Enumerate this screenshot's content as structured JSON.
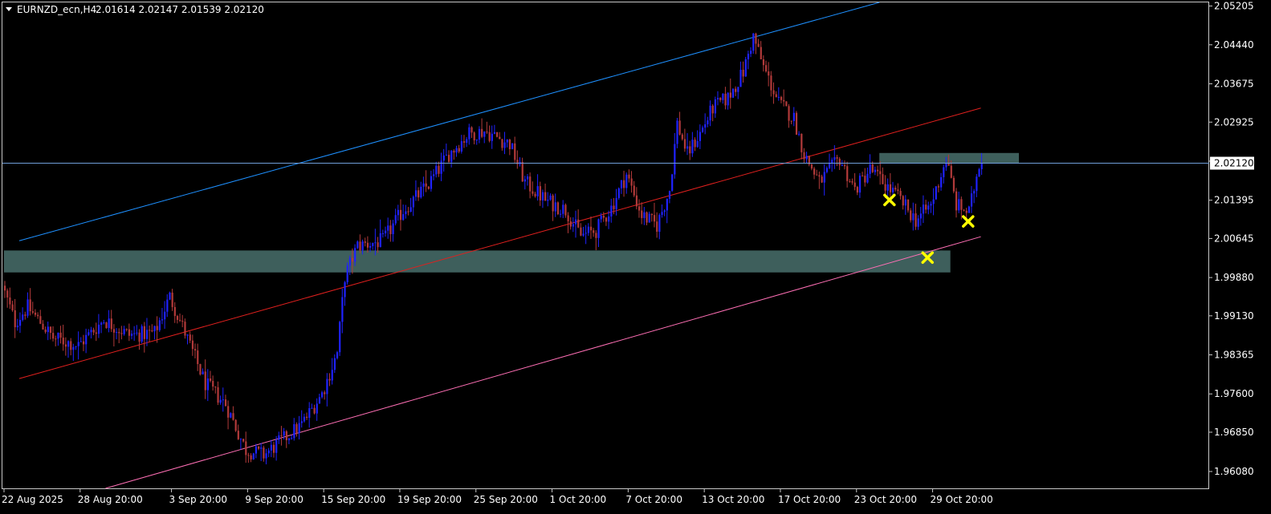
{
  "header": {
    "symbol": "EURNZD_ecn,H4",
    "ohlc": "2.01614 2.02147 2.01539 2.02120"
  },
  "colors": {
    "background": "#000000",
    "frame": "#c8c8c8",
    "bull_candle": "#1f22ff",
    "bear_candle": "#b23a3a",
    "channel_upper": "#1e90ff",
    "channel_middle": "#e0201e",
    "channel_lower": "#ff6fb5",
    "zone_fill": "#3e5f5c",
    "current_price_line": "#6f9ed8",
    "marker": "#ffff00",
    "label_bg": "#ffffff"
  },
  "current_price": {
    "value": 2.0212,
    "label": "2.02120"
  },
  "chart_data": {
    "type": "candlestick",
    "symbol": "EURNZD_ecn",
    "timeframe": "H4",
    "ylim": [
      1.9575,
      2.0527
    ],
    "y_ticks": [
      {
        "value": 2.052,
        "label": "2.05205"
      },
      {
        "value": 2.0444,
        "label": "2.04440"
      },
      {
        "value": 2.03675,
        "label": "2.03675"
      },
      {
        "value": 2.02925,
        "label": "2.02925"
      },
      {
        "value": 2.0216,
        "label": "2.02160"
      },
      {
        "value": 2.01395,
        "label": "2.01395"
      },
      {
        "value": 2.00645,
        "label": "2.00645"
      },
      {
        "value": 1.9988,
        "label": "1.99880"
      },
      {
        "value": 1.9913,
        "label": "1.99130"
      },
      {
        "value": 1.98365,
        "label": "1.98365"
      },
      {
        "value": 1.976,
        "label": "1.97600"
      },
      {
        "value": 1.9685,
        "label": "1.96850"
      },
      {
        "value": 1.9608,
        "label": "1.96080"
      }
    ],
    "x_ticks": [
      {
        "index": 0,
        "label": "22 Aug 2025"
      },
      {
        "index": 30,
        "label": "28 Aug 20:00"
      },
      {
        "index": 66,
        "label": "3 Sep 20:00"
      },
      {
        "index": 96,
        "label": "9 Sep 20:00"
      },
      {
        "index": 126,
        "label": "15 Sep 20:00"
      },
      {
        "index": 156,
        "label": "19 Sep 20:00"
      },
      {
        "index": 186,
        "label": "25 Sep 20:00"
      },
      {
        "index": 216,
        "label": "1 Oct 20:00"
      },
      {
        "index": 246,
        "label": "7 Oct 20:00"
      },
      {
        "index": 276,
        "label": "13 Oct 20:00"
      },
      {
        "index": 306,
        "label": "17 Oct 20:00"
      },
      {
        "index": 336,
        "label": "23 Oct 20:00"
      },
      {
        "index": 366,
        "label": "29 Oct 20:00"
      }
    ],
    "bar_count": 386,
    "price_path": [
      [
        0,
        1.9972
      ],
      [
        5,
        1.99
      ],
      [
        10,
        1.993
      ],
      [
        20,
        1.987
      ],
      [
        30,
        1.9855
      ],
      [
        40,
        1.9905
      ],
      [
        50,
        1.9875
      ],
      [
        60,
        1.988
      ],
      [
        66,
        1.995
      ],
      [
        72,
        1.988
      ],
      [
        80,
        1.978
      ],
      [
        88,
        1.974
      ],
      [
        96,
        1.965
      ],
      [
        103,
        1.964
      ],
      [
        108,
        1.966
      ],
      [
        118,
        1.97
      ],
      [
        126,
        1.976
      ],
      [
        132,
        1.984
      ],
      [
        135,
        1.999
      ],
      [
        140,
        2.005
      ],
      [
        150,
        2.006
      ],
      [
        158,
        2.012
      ],
      [
        168,
        2.017
      ],
      [
        176,
        2.023
      ],
      [
        184,
        2.027
      ],
      [
        190,
        2.0275
      ],
      [
        200,
        2.025
      ],
      [
        206,
        2.0175
      ],
      [
        214,
        2.014
      ],
      [
        222,
        2.012
      ],
      [
        228,
        2.007
      ],
      [
        234,
        2.008
      ],
      [
        240,
        2.0125
      ],
      [
        246,
        2.019
      ],
      [
        252,
        2.011
      ],
      [
        258,
        2.009
      ],
      [
        263,
        2.016
      ],
      [
        266,
        2.029
      ],
      [
        270,
        2.023
      ],
      [
        275,
        2.027
      ],
      [
        280,
        2.032
      ],
      [
        286,
        2.034
      ],
      [
        292,
        2.039
      ],
      [
        296,
        2.046
      ],
      [
        300,
        2.04
      ],
      [
        306,
        2.033
      ],
      [
        312,
        2.03
      ],
      [
        316,
        2.023
      ],
      [
        322,
        2.0175
      ],
      [
        330,
        2.022
      ],
      [
        336,
        2.016
      ],
      [
        342,
        2.02
      ],
      [
        348,
        2.017
      ],
      [
        354,
        2.014
      ],
      [
        360,
        2.01
      ],
      [
        366,
        2.013
      ],
      [
        372,
        2.022
      ],
      [
        376,
        2.013
      ],
      [
        381,
        2.0115
      ],
      [
        385,
        2.0212
      ]
    ],
    "channels": [
      {
        "name": "upper",
        "x0": 6,
        "y0": 2.006,
        "x1": 345,
        "y1": 2.0527
      },
      {
        "name": "middle",
        "x0": 6,
        "y0": 1.979,
        "x1": 385,
        "y1": 2.032
      },
      {
        "name": "lower",
        "x0": 40,
        "y0": 1.9575,
        "x1": 385,
        "y1": 2.0068
      }
    ],
    "zones": [
      {
        "name": "support",
        "x0": 0,
        "x1": 373,
        "y_high": 2.0041,
        "y_low": 1.9998
      },
      {
        "name": "resistance",
        "x0": 345,
        "x1": 400,
        "y_high": 2.0232,
        "y_low": 2.0212
      }
    ],
    "markers": [
      {
        "x": 349,
        "y": 2.014
      },
      {
        "x": 364,
        "y": 2.0027
      },
      {
        "x": 380,
        "y": 2.0098
      }
    ]
  }
}
